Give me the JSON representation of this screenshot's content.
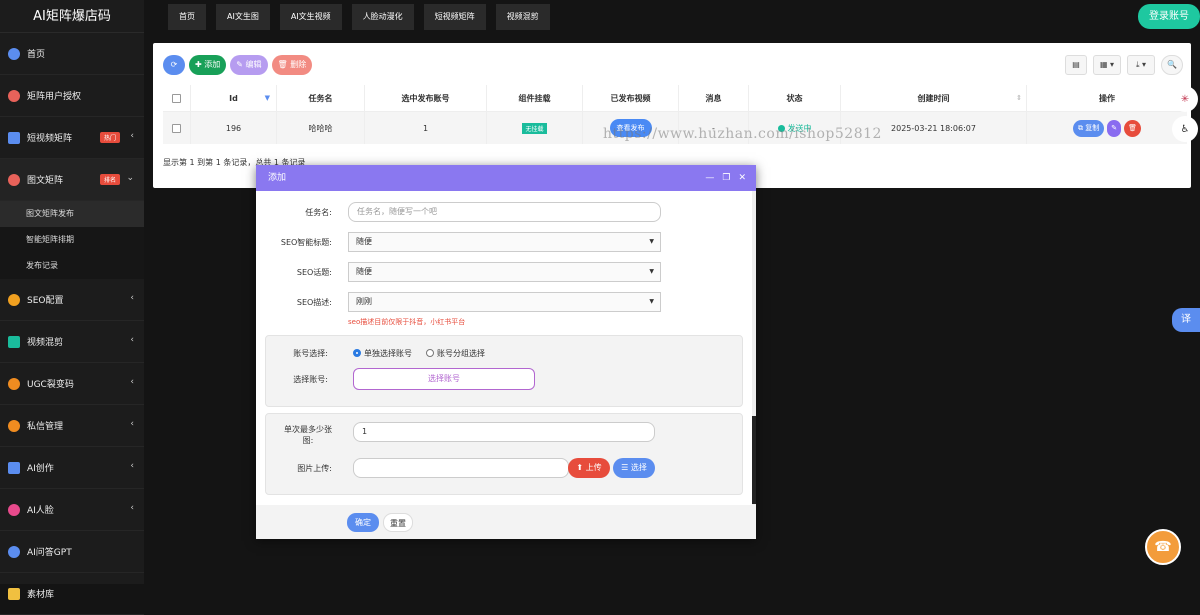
{
  "brand": "AI矩阵爆店码",
  "sidebar": {
    "items": [
      {
        "label": "首页",
        "icon": "pie-chart-icon",
        "color": "#5b8def"
      },
      {
        "label": "矩阵用户授权",
        "icon": "user-auth-icon",
        "color": "#e8625a"
      },
      {
        "label": "短视频矩阵",
        "icon": "video-icon",
        "color": "#5b8def",
        "badge": "热门",
        "chevron": "‹"
      },
      {
        "label": "图文矩阵",
        "icon": "image-text-icon",
        "color": "#e8625a",
        "badge": "排名",
        "chevron": "⌄"
      },
      {
        "label": "SEO配置",
        "icon": "seo-icon",
        "color": "#f0a020",
        "chevron": "‹"
      },
      {
        "label": "视频混剪",
        "icon": "mix-video-icon",
        "color": "#1abc9c",
        "chevron": "‹"
      },
      {
        "label": "UGC裂变码",
        "icon": "qrcode-icon",
        "color": "#f08c20",
        "chevron": "‹"
      },
      {
        "label": "私信管理",
        "icon": "message-icon",
        "color": "#f08c20",
        "chevron": "‹"
      },
      {
        "label": "AI创作",
        "icon": "play-icon",
        "color": "#5b8def",
        "chevron": "‹"
      },
      {
        "label": "AI人脸",
        "icon": "face-icon",
        "color": "#e84a8c",
        "chevron": "‹"
      },
      {
        "label": "AI问答GPT",
        "icon": "ai-icon",
        "color": "#5b8def"
      },
      {
        "label": "素材库",
        "icon": "folder-icon",
        "color": "#f0c040"
      }
    ],
    "submenu": [
      "图文矩阵发布",
      "智能矩阵排期",
      "发布记录"
    ]
  },
  "topnav": [
    "首页",
    "AI文生图",
    "AI文生视频",
    "人脸动漫化",
    "短视频矩阵",
    "视频混剪"
  ],
  "login_label": "登录账号",
  "toolbar": {
    "refresh_icon": "refresh-icon",
    "add_label": "✚ 添加",
    "edit_label": "✎ 编辑",
    "delete_label": "🗑 删除",
    "columns_icon": "▤",
    "grid_icon": "▦ ▾",
    "export_icon": "⤓ ▾",
    "search_icon": "🔍"
  },
  "table": {
    "headers": [
      "Id",
      "任务名",
      "选中发布账号",
      "组件挂载",
      "已发布视频",
      "消息",
      "状态",
      "创建时间",
      "操作"
    ],
    "rows": [
      {
        "id": "196",
        "name": "哈哈哈",
        "accounts": "1",
        "mount": "无挂载",
        "published": "查看发布",
        "message": "-",
        "status": "发送中",
        "created": "2025-03-21 18:06:07"
      }
    ],
    "ops": {
      "copy": "复制",
      "edit_icon": "✎",
      "delete_icon": "🗑"
    },
    "summary": "显示第 1 到第 1 条记录，总共 1 条记录"
  },
  "watermark": "https://www.huzhan.com/ishop52812",
  "translate_label": "译",
  "modal": {
    "title": "添加",
    "controls": [
      "—",
      "❐",
      "✕"
    ],
    "fields": {
      "task_label": "任务名:",
      "task_placeholder": "任务名，随便写一个吧",
      "seo_title_label": "SEO智能标题:",
      "seo_title_value": "随便",
      "seo_topic_label": "SEO话题:",
      "seo_topic_value": "随便",
      "seo_desc_label": "SEO描述:",
      "seo_desc_value": "刚刚",
      "hint": "seo描述目前仅限于抖音，小红书平台"
    },
    "account": {
      "label": "账号选择:",
      "option_single": "单独选择账号",
      "option_group": "账号分组选择",
      "pick_label": "选择账号:",
      "pick_button": "选择账号"
    },
    "images": {
      "max_label": "单次最多少张\n图:",
      "max_value": "1",
      "upload_label": "图片上传:",
      "upload_button": "⬆ 上传",
      "select_button": "☰ 选择"
    },
    "footer": {
      "ok": "确定",
      "reset": "重置"
    }
  }
}
